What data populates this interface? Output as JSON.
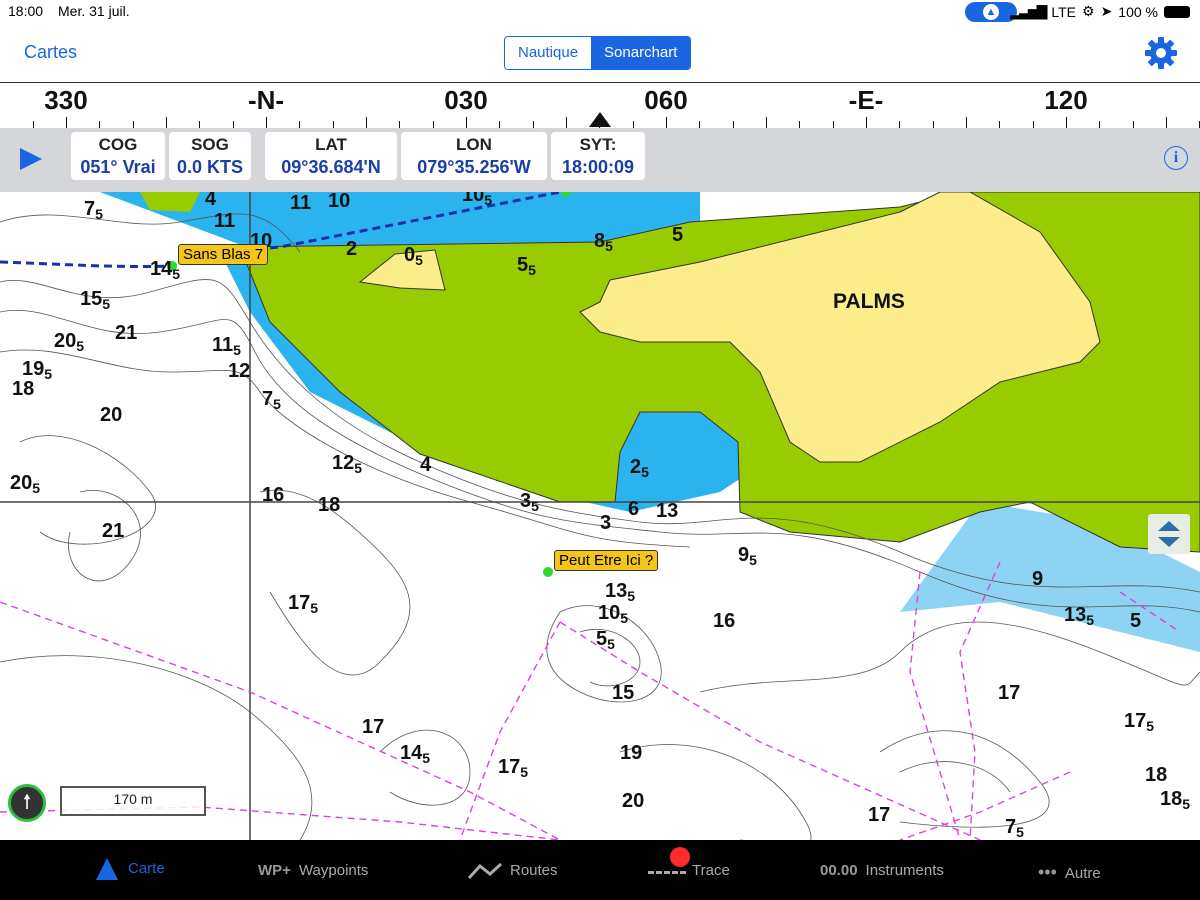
{
  "status": {
    "time": "18:00",
    "date": "Mer. 31 juil.",
    "network": "LTE",
    "battery": "100 %"
  },
  "nav": {
    "back": "Cartes",
    "segments": [
      "Nautique",
      "Sonarchart"
    ],
    "selected_segment": "Sonarchart"
  },
  "compass": {
    "labels": [
      "330",
      "-N-",
      "030",
      "060",
      "-E-",
      "120"
    ]
  },
  "instruments": [
    {
      "label": "COG",
      "value": "051° Vrai"
    },
    {
      "label": "SOG",
      "value": "0.0 KTS"
    },
    {
      "label": "LAT",
      "value": "09°36.684'N"
    },
    {
      "label": "LON",
      "value": "079°35.256'W"
    },
    {
      "label": "SYT:",
      "value": "18:00:09"
    }
  ],
  "map": {
    "place_label": "PALMS",
    "waypoints": [
      "Sans Blas 7",
      "Peut Etre Ici ?"
    ],
    "scale": "170 m",
    "colors": {
      "land": "#99cc00",
      "island": "#fbee8a",
      "shallow": "#2ab3ef",
      "route": "#1a2fb0",
      "track": "#e040e0"
    }
  },
  "tabs": [
    {
      "icon": "triangle-icon",
      "label": "Carte"
    },
    {
      "icon": "WP+",
      "label": "Waypoints"
    },
    {
      "icon": "route-icon",
      "label": "Routes"
    },
    {
      "icon": "trace-icon",
      "label": "Trace"
    },
    {
      "icon": "00.00",
      "label": "Instruments"
    },
    {
      "icon": "•••",
      "label": "Autre"
    }
  ]
}
